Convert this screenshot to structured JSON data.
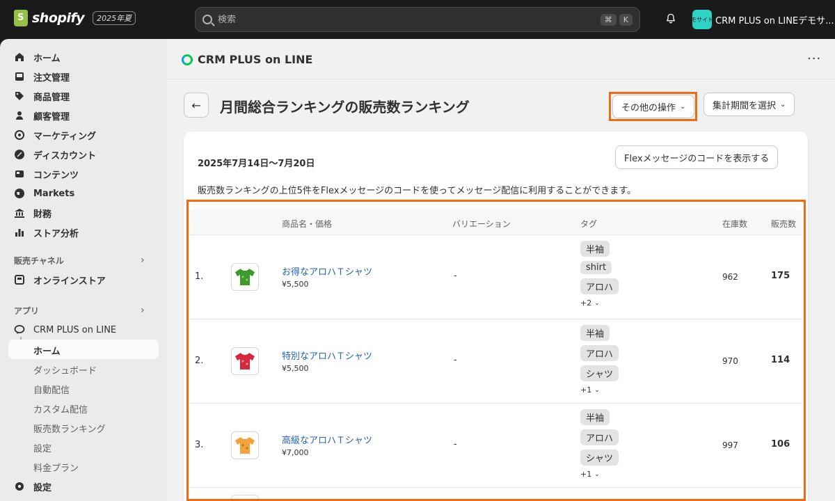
{
  "topbar": {
    "brand": "shopify",
    "edition": "2025年夏",
    "search_placeholder": "検索",
    "shortcut_keys": [
      "⌘",
      "K"
    ],
    "store_avatar_text": "モサイト",
    "store_name": "CRM PLUS on LINEデモサ..."
  },
  "sidebar": {
    "items": [
      {
        "label": "ホーム",
        "icon": "home-icon"
      },
      {
        "label": "注文管理",
        "icon": "inbox-icon"
      },
      {
        "label": "商品管理",
        "icon": "tag-icon"
      },
      {
        "label": "顧客管理",
        "icon": "person-icon"
      },
      {
        "label": "マーケティング",
        "icon": "target-icon"
      },
      {
        "label": "ディスカウント",
        "icon": "discount-icon"
      },
      {
        "label": "コンテンツ",
        "icon": "content-icon"
      },
      {
        "label": "Markets",
        "icon": "globe-icon"
      },
      {
        "label": "財務",
        "icon": "bank-icon"
      },
      {
        "label": "ストア分析",
        "icon": "chart-icon"
      }
    ],
    "sales_channels_title": "販売チャネル",
    "online_store": "オンラインストア",
    "apps_title": "アプリ",
    "app_name": "CRM PLUS on LINE",
    "app_sub_items": [
      "ホーム",
      "ダッシュボード",
      "自動配信",
      "カスタム配信",
      "販売数ランキング",
      "設定",
      "料金プラン"
    ],
    "settings": "設定"
  },
  "app_header": {
    "title": "CRM PLUS on LINE",
    "more": "···"
  },
  "page": {
    "back": "←",
    "title": "月間総合ランキングの販売数ランキング",
    "more_actions": "その他の操作",
    "select_period": "集計期間を選択",
    "period": "2025年7月14日〜7月20日",
    "flex_button": "Flexメッセージのコードを表示する",
    "description": "販売数ランキングの上位5件をFlexメッセージのコードを使ってメッセージ配信に利用することができます。"
  },
  "table": {
    "headers": {
      "product": "商品名・価格",
      "variation": "バリエーション",
      "tags": "タグ",
      "stock": "在庫数",
      "sales": "販売数"
    },
    "rows": [
      {
        "rank": "1.",
        "name": "お得なアロハＴシャツ",
        "price": "¥5,500",
        "variation": "-",
        "tags": [
          "半袖",
          "shirt",
          "アロハ"
        ],
        "more": "+2",
        "stock": "962",
        "sales": "175",
        "color": "#3f9a2e"
      },
      {
        "rank": "2.",
        "name": "特別なアロハＴシャツ",
        "price": "¥5,500",
        "variation": "-",
        "tags": [
          "半袖",
          "アロハ",
          "シャツ"
        ],
        "more": "+1",
        "stock": "970",
        "sales": "114",
        "color": "#d7263d"
      },
      {
        "rank": "3.",
        "name": "高級なアロハＴシャツ",
        "price": "¥7,000",
        "variation": "-",
        "tags": [
          "半袖",
          "アロハ",
          "シャツ"
        ],
        "more": "+1",
        "stock": "997",
        "sales": "106",
        "color": "#f2a33a"
      }
    ]
  },
  "highlight_color": "#f26a12"
}
